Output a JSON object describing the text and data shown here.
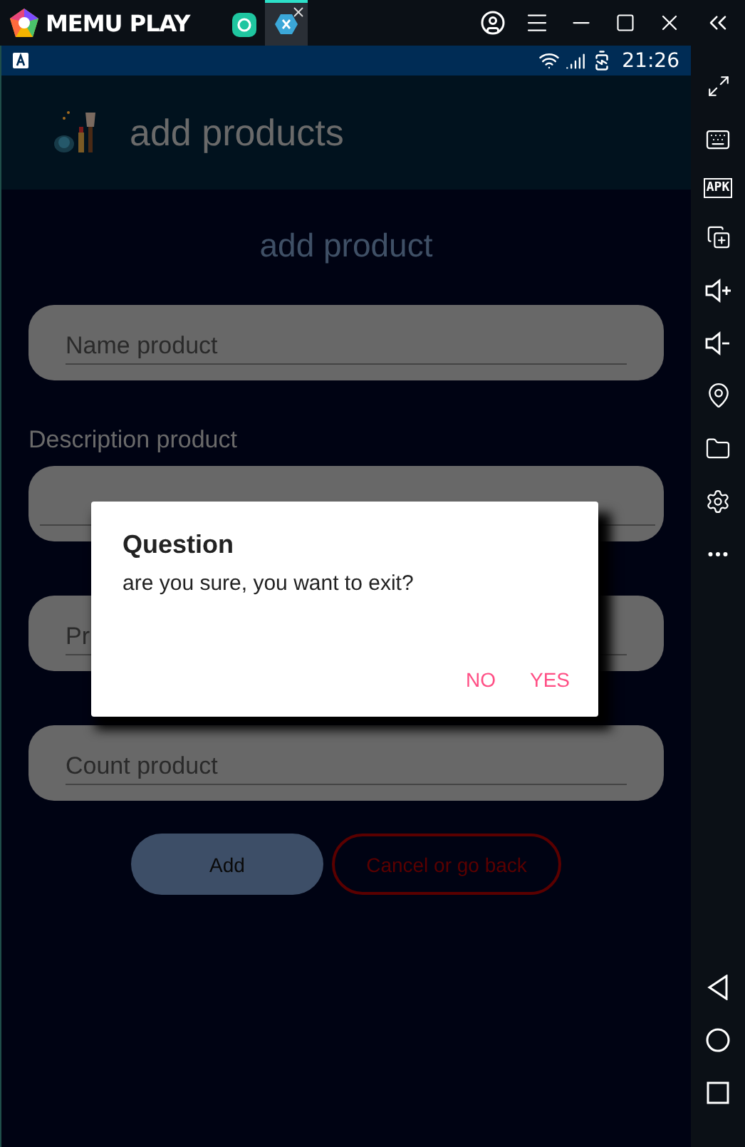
{
  "title_bar": {
    "brand": "MEMU PLAY",
    "tabs": [
      {
        "kind": "home",
        "selected": false
      },
      {
        "kind": "app",
        "selected": true
      }
    ]
  },
  "status_bar": {
    "time": "21:26"
  },
  "app_bar": {
    "title": "add products"
  },
  "form": {
    "heading": "add product",
    "fields": [
      {
        "placeholder": "Name product"
      },
      {
        "label": "Description product"
      },
      {
        "placeholder": "Pr"
      },
      {
        "placeholder": "Count product"
      }
    ],
    "buttons": [
      {
        "kind": "filled",
        "label": "Add"
      },
      {
        "kind": "outlined",
        "label": "Cancel or go back"
      }
    ]
  },
  "dialog": {
    "title": "Question",
    "message": "are you sure, you want to exit?",
    "actions": [
      "NO",
      "YES"
    ]
  },
  "side_toolbar": {
    "apk_label": "APK"
  }
}
